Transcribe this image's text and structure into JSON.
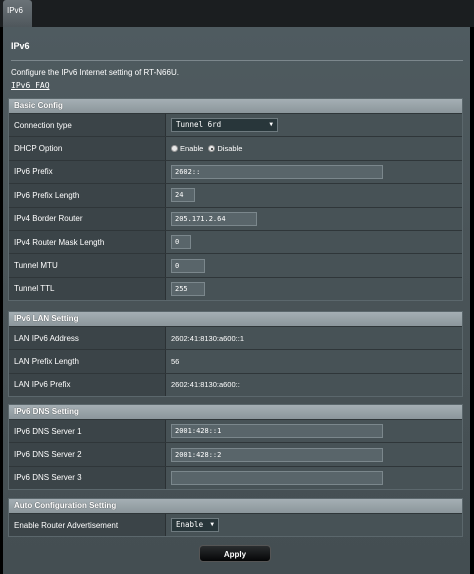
{
  "tab": {
    "label": "IPv6"
  },
  "page": {
    "title": "IPv6",
    "description": "Configure the IPv6 Internet setting of RT-N66U.",
    "faq_link": "IPv6 FAQ"
  },
  "basic": {
    "header": "Basic Config",
    "connection_type": {
      "label": "Connection type",
      "value": "Tunnel 6rd"
    },
    "dhcp": {
      "label": "DHCP Option",
      "enable": "Enable",
      "disable": "Disable",
      "selected": "Disable"
    },
    "prefix": {
      "label": "IPv6 Prefix",
      "value": "2602::"
    },
    "prefix_length": {
      "label": "IPv6 Prefix Length",
      "value": "24"
    },
    "border_router": {
      "label": "IPv4 Border Router",
      "value": "205.171.2.64"
    },
    "mask_length": {
      "label": "IPv4 Router Mask Length",
      "value": "0"
    },
    "mtu": {
      "label": "Tunnel MTU",
      "value": "0"
    },
    "ttl": {
      "label": "Tunnel TTL",
      "value": "255"
    }
  },
  "lan": {
    "header": "IPv6 LAN Setting",
    "address": {
      "label": "LAN IPv6 Address",
      "value": "2602:41:8130:a600::1"
    },
    "prefix_length": {
      "label": "LAN Prefix Length",
      "value": "56"
    },
    "prefix": {
      "label": "LAN IPv6 Prefix",
      "value": "2602:41:8130:a600::"
    }
  },
  "dns": {
    "header": "IPv6 DNS Setting",
    "server1": {
      "label": "IPv6 DNS Server 1",
      "value": "2001:428::1"
    },
    "server2": {
      "label": "IPv6 DNS Server 2",
      "value": "2001:428::2"
    },
    "server3": {
      "label": "IPv6 DNS Server 3",
      "value": ""
    }
  },
  "auto": {
    "header": "Auto Configuration Setting",
    "router_adv": {
      "label": "Enable Router Advertisement",
      "value": "Enable"
    }
  },
  "apply_label": "Apply"
}
